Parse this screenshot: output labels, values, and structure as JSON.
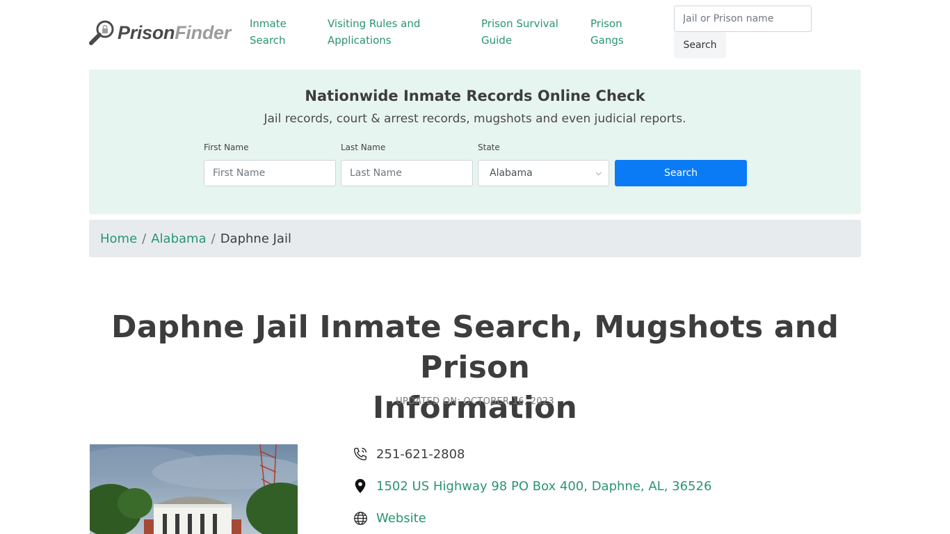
{
  "brand": {
    "part1": "Prison",
    "part2": "Finder"
  },
  "nav": [
    {
      "line1": "Inmate",
      "line2": "Search"
    },
    {
      "line1": "Visiting Rules and",
      "line2": "Applications"
    },
    {
      "line1": "Prison Survival",
      "line2": "Guide"
    },
    {
      "line1": "Prison",
      "line2": "Gangs"
    }
  ],
  "site_search": {
    "placeholder": "Jail or Prison name",
    "button_label": "Search"
  },
  "records": {
    "title": "Nationwide Inmate Records Online Check",
    "subtitle": "Jail records, court & arrest records, mugshots and even judicial reports.",
    "first_name_label": "First Name",
    "first_name_placeholder": "First Name",
    "last_name_label": "Last Name",
    "last_name_placeholder": "Last Name",
    "state_label": "State",
    "state_selected": "Alabama",
    "button_label": "Search"
  },
  "breadcrumb": {
    "home": "Home",
    "state": "Alabama",
    "current": "Daphne Jail",
    "separator": "/"
  },
  "page": {
    "title_line1": "Daphne Jail Inmate Search, Mugshots and Prison",
    "title_line2": "Information",
    "updated": "UPDATED ON: OCTOBER 16, 2023"
  },
  "info": {
    "phone": "251-621-2808",
    "address": "1502 US Highway 98 PO Box 400, Daphne, AL, 36526",
    "website_label": "Website"
  },
  "colors": {
    "link": "#2a9470",
    "panel_bg": "#e7f5f0",
    "primary_button": "#0b7bf5",
    "breadcrumb_bg": "#e8ebee"
  }
}
